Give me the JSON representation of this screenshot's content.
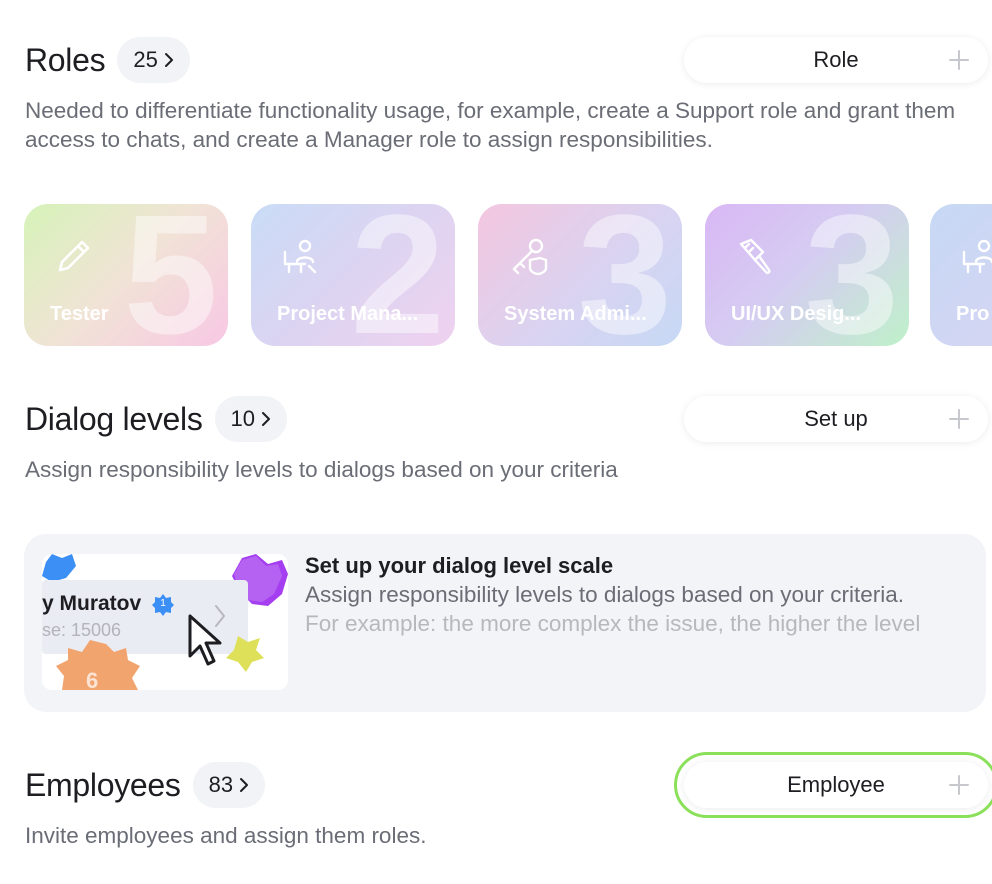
{
  "roles": {
    "title": "Roles",
    "count": "25",
    "description": "Needed to differentiate functionality usage, for example, create a Support role and grant them access to chats, and create a Manager role to assign responsibilities.",
    "add_label": "Role",
    "cards": [
      {
        "name": "Tester",
        "number": "5",
        "icon": "pencil-icon"
      },
      {
        "name": "Project Mana...",
        "number": "2",
        "icon": "person-at-desk-icon"
      },
      {
        "name": "System Admi...",
        "number": "3",
        "icon": "key-shield-icon"
      },
      {
        "name": "UI/UX Desig...",
        "number": "3",
        "icon": "paint-brush-icon"
      },
      {
        "name": "Pro",
        "number": "",
        "icon": "person-at-desk-icon"
      }
    ]
  },
  "dialog_levels": {
    "title": "Dialog levels",
    "count": "10",
    "description": "Assign responsibility levels to dialogs based on your criteria",
    "add_label": "Set up",
    "setup_card": {
      "title": "Set up your dialog level scale",
      "description": "Assign responsibility levels to dialogs based on your criteria.",
      "example": "For example: the more complex the issue, the higher the level",
      "preview_name": "y Muratov",
      "preview_sub": "se: 15006",
      "preview_badge": "1",
      "preview_level": "6"
    }
  },
  "employees": {
    "title": "Employees",
    "count": "83",
    "description": "Invite employees and assign them roles.",
    "add_label": "Employee"
  }
}
